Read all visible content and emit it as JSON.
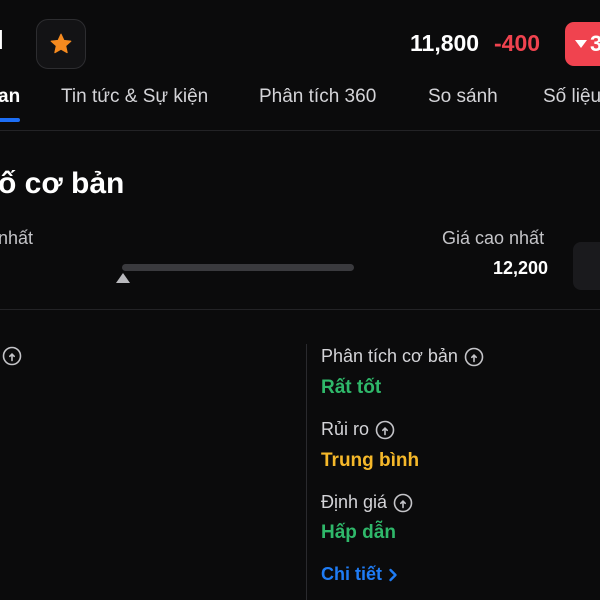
{
  "header": {
    "ticker": "I",
    "price": "11,800",
    "change": "-400",
    "change_pct": "3",
    "colors": {
      "down": "#f0434f",
      "star": "#f58a1f",
      "accent": "#1d6ef5"
    }
  },
  "tabs": [
    {
      "label": "an",
      "active": true
    },
    {
      "label": "Tin tức & Sự kiện"
    },
    {
      "label": "Phân tích 360"
    },
    {
      "label": "So sánh"
    },
    {
      "label": "Số liệu"
    }
  ],
  "section": {
    "title": "ố cơ bản",
    "range": {
      "low_label": "nhất",
      "high_label": "Giá cao nhất",
      "high_value": "12,200"
    }
  },
  "metrics": [
    {
      "label": "Phân tích cơ bản",
      "value": "Rất tốt",
      "color": "#2fb86a"
    },
    {
      "label": "Rủi ro",
      "value": "Trung bình",
      "color": "#f5b82a"
    },
    {
      "label": "Định giá",
      "value": "Hấp dẫn",
      "color": "#2fb86a"
    }
  ],
  "detail_link": "Chi tiết"
}
